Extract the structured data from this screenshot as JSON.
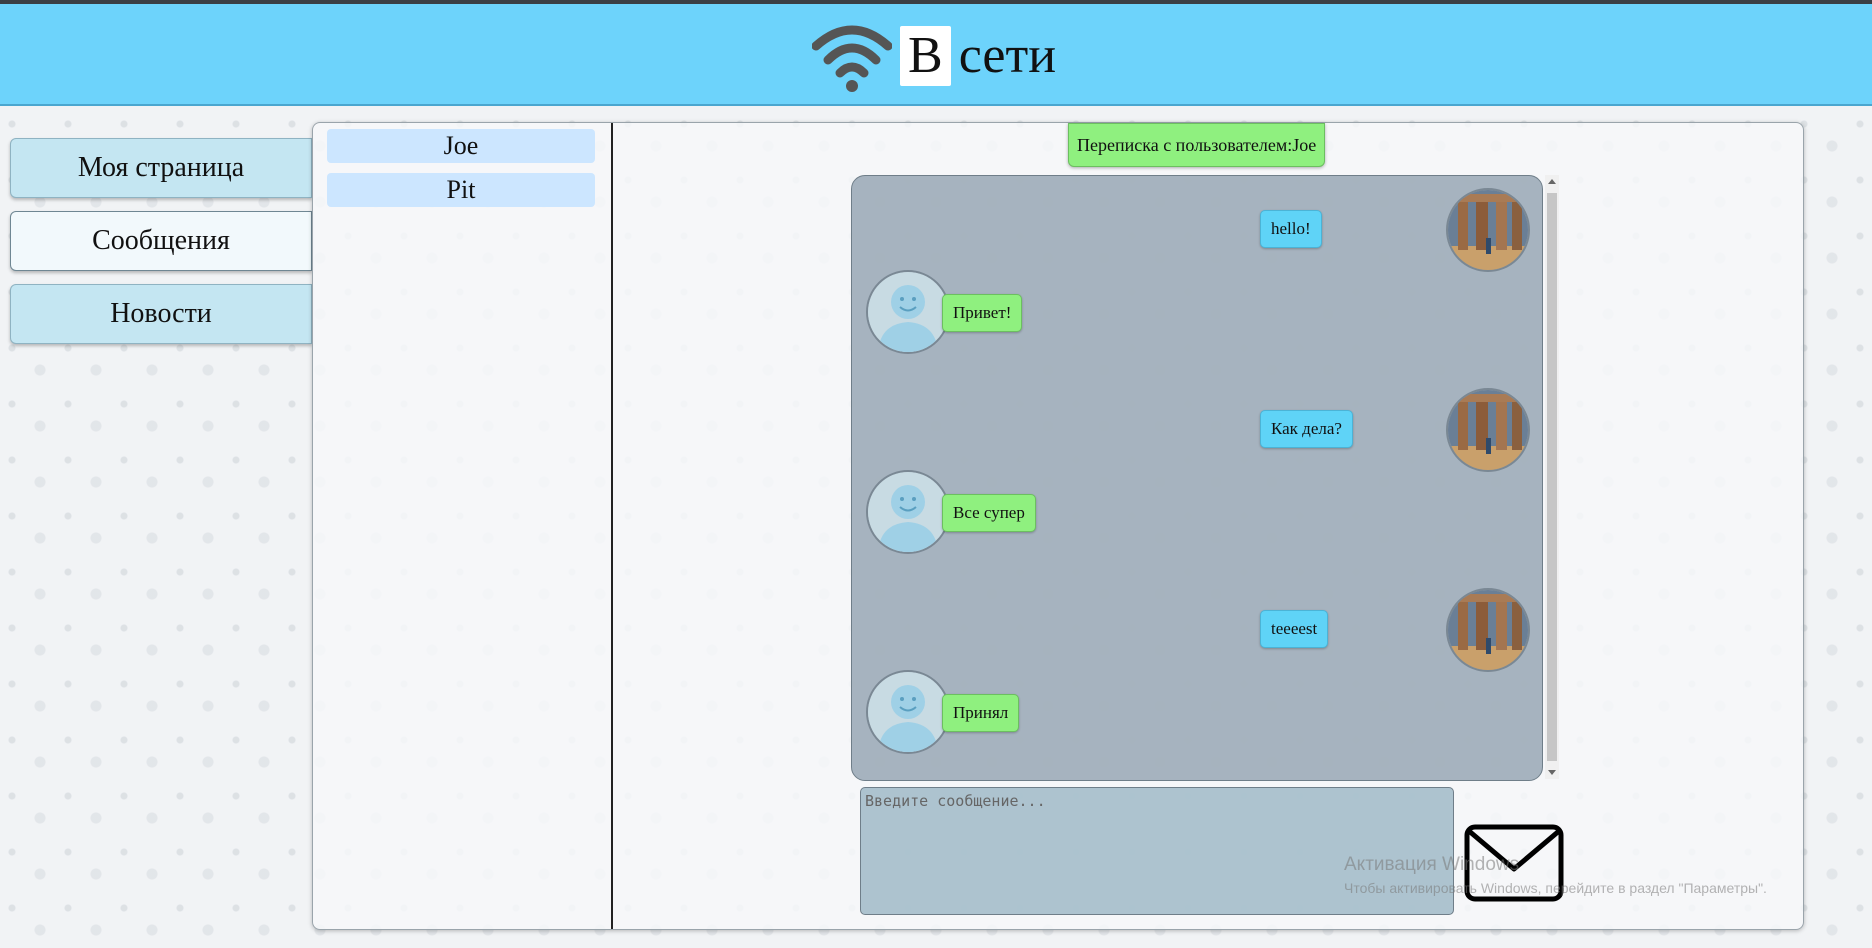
{
  "header": {
    "logo_boxed": "В",
    "logo_text": "сети"
  },
  "nav": {
    "items": [
      {
        "label": "Моя страница"
      },
      {
        "label": "Сообщения",
        "active": true
      },
      {
        "label": "Новости"
      }
    ]
  },
  "contacts": [
    {
      "name": "Joe"
    },
    {
      "name": "Pit"
    }
  ],
  "chat": {
    "title": "Переписка с пользователем:Joe",
    "messages": [
      {
        "text": "hello!",
        "from": "me"
      },
      {
        "text": "Привет!",
        "from": "other"
      },
      {
        "text": "Как дела?",
        "from": "me"
      },
      {
        "text": "Все супер",
        "from": "other"
      },
      {
        "text": "teeeest",
        "from": "me"
      },
      {
        "text": "Принял",
        "from": "other"
      }
    ],
    "input_placeholder": "Введите сообщение...",
    "send_icon": "envelope-icon"
  },
  "watermark": {
    "line1": "Активация Windows",
    "line2": "Чтобы активировать Windows, перейдите в раздел \"Параметры\"."
  }
}
